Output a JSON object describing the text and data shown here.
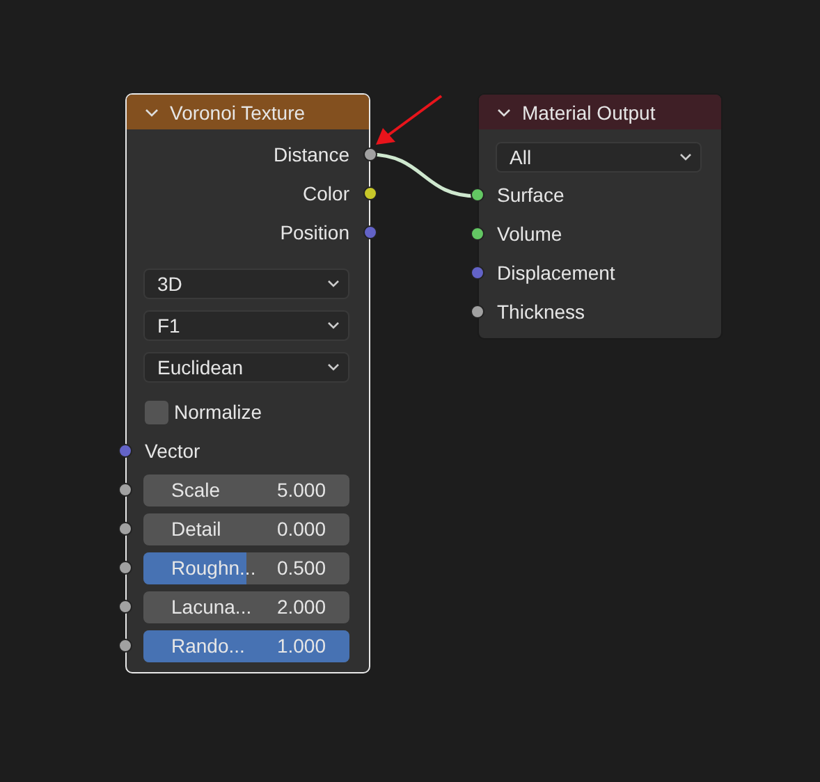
{
  "nodes": [
    {
      "title": "Voronoi Texture",
      "kind": "texture",
      "selected": true,
      "outputs": [
        {
          "label": "Distance",
          "color": "#a1a1a1"
        },
        {
          "label": "Color",
          "color": "#c7c729"
        },
        {
          "label": "Position",
          "color": "#6363c7"
        }
      ],
      "dropdowns": [
        "3D",
        "F1",
        "Euclidean"
      ],
      "checkbox": {
        "label": "Normalize",
        "checked": false
      },
      "inputs": [
        {
          "label": "Vector",
          "kind": "plain",
          "color": "#6363c7"
        },
        {
          "label": "Scale",
          "kind": "number",
          "value": "5.000",
          "color": "#a1a1a1"
        },
        {
          "label": "Detail",
          "kind": "number",
          "value": "0.000",
          "color": "#a1a1a1"
        },
        {
          "label": "Roughn...",
          "kind": "slider",
          "value": "0.500",
          "level": 0.5,
          "color": "#a1a1a1"
        },
        {
          "label": "Lacuna...",
          "kind": "number",
          "value": "2.000",
          "color": "#a1a1a1"
        },
        {
          "label": "Rando...",
          "kind": "slider",
          "value": "1.000",
          "level": 1,
          "color": "#a1a1a1"
        }
      ]
    },
    {
      "title": "Material Output",
      "kind": "output",
      "selected": false,
      "dropdowns": [
        "All"
      ],
      "inputs": [
        {
          "label": "Surface",
          "kind": "plain",
          "color": "#63c763"
        },
        {
          "label": "Volume",
          "kind": "plain",
          "color": "#63c763"
        },
        {
          "label": "Displacement",
          "kind": "plain",
          "color": "#6363c7"
        },
        {
          "label": "Thickness",
          "kind": "plain",
          "color": "#a1a1a1"
        }
      ]
    }
  ]
}
